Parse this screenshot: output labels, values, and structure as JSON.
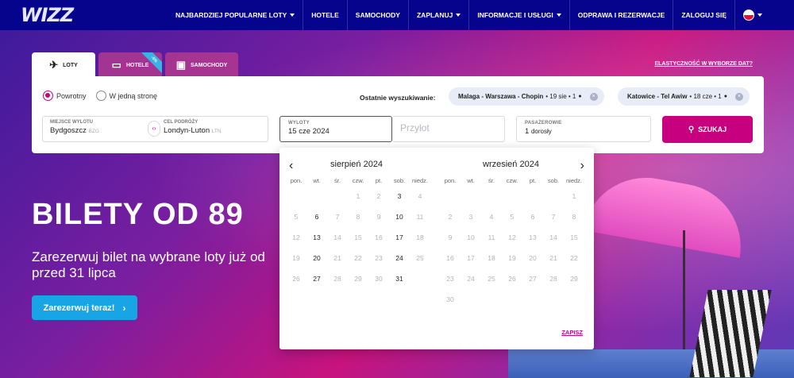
{
  "brand": {
    "logo": "WIZZ"
  },
  "nav": {
    "items": [
      {
        "label": "NAJBARDZIEJ POPULARNE LOTY",
        "caret": true
      },
      {
        "label": "HOTELE",
        "caret": false
      },
      {
        "label": "SAMOCHODY",
        "caret": false
      },
      {
        "label": "ZAPLANUJ",
        "caret": true
      },
      {
        "label": "INFORMACJE I USŁUGI",
        "caret": true
      },
      {
        "label": "ODPRAWA I REZERWACJE",
        "caret": false
      },
      {
        "label": "ZALOGUJ SIĘ",
        "caret": false
      }
    ],
    "language_caret": true
  },
  "tabs": {
    "flights": "LOTY",
    "hotels": "HOTELE",
    "hotels_badge": "-5%",
    "cars": "SAMOCHODY"
  },
  "flex_link": "ELASTYCZNOŚĆ W WYBORZE DAT?",
  "trip_type": {
    "roundtrip": "Powrotny",
    "oneway": "W jedną stronę",
    "selected": "roundtrip"
  },
  "recent": {
    "label": "Ostatnie wyszukiwanie:",
    "chips": [
      {
        "route": "Malaga - Warszawa - Chopin",
        "details": "• 19 sie • 1"
      },
      {
        "route": "Katowice - Tel Awiw",
        "details": "• 18 cze • 1"
      }
    ]
  },
  "search": {
    "origin_label": "MIEJSCE WYLOTU",
    "origin_value": "Bydgoszcz",
    "origin_code": "BZG",
    "dest_label": "CEL PODRÓŻY",
    "dest_value": "Londyn-Luton",
    "dest_code": "LTN",
    "depart_label": "WYLOTY",
    "depart_value": "15 cze 2024",
    "return_placeholder": "Przylot",
    "pax_label": "PASAŻEROWIE",
    "pax_count": "1",
    "pax_unit": "dorosły",
    "button": "SZUKAJ"
  },
  "hero": {
    "headline": "BILETY OD 89",
    "sub_line1": "Zarezerwuj bilet na wybrane loty już od",
    "sub_line2": "przed 31 lipca",
    "cta": "Zarezerwuj teraz!"
  },
  "calendar": {
    "dow": [
      "pon.",
      "wt.",
      "śr.",
      "czw.",
      "pt.",
      "sob.",
      "niedz."
    ],
    "months": [
      {
        "title": "sierpień 2024",
        "weeks": [
          [
            null,
            null,
            null,
            "1",
            "2",
            "3",
            "4"
          ],
          [
            "5",
            "6",
            "7",
            "8",
            "9",
            "10",
            "11"
          ],
          [
            "12",
            "13",
            "14",
            "15",
            "16",
            "17",
            "18"
          ],
          [
            "19",
            "20",
            "21",
            "22",
            "23",
            "24",
            "25"
          ],
          [
            "26",
            "27",
            "28",
            "29",
            "30",
            "31",
            null
          ]
        ],
        "enabled": [
          "3",
          "6",
          "10",
          "13",
          "17",
          "20",
          "24",
          "27",
          "31"
        ]
      },
      {
        "title": "wrzesień 2024",
        "weeks": [
          [
            null,
            null,
            null,
            null,
            null,
            null,
            "1"
          ],
          [
            "2",
            "3",
            "4",
            "5",
            "6",
            "7",
            "8"
          ],
          [
            "9",
            "10",
            "11",
            "12",
            "13",
            "14",
            "15"
          ],
          [
            "16",
            "17",
            "18",
            "19",
            "20",
            "21",
            "22"
          ],
          [
            "23",
            "24",
            "25",
            "26",
            "27",
            "28",
            "29"
          ],
          [
            "30",
            null,
            null,
            null,
            null,
            null,
            null
          ]
        ],
        "enabled": []
      }
    ],
    "save": "ZAPISZ"
  }
}
